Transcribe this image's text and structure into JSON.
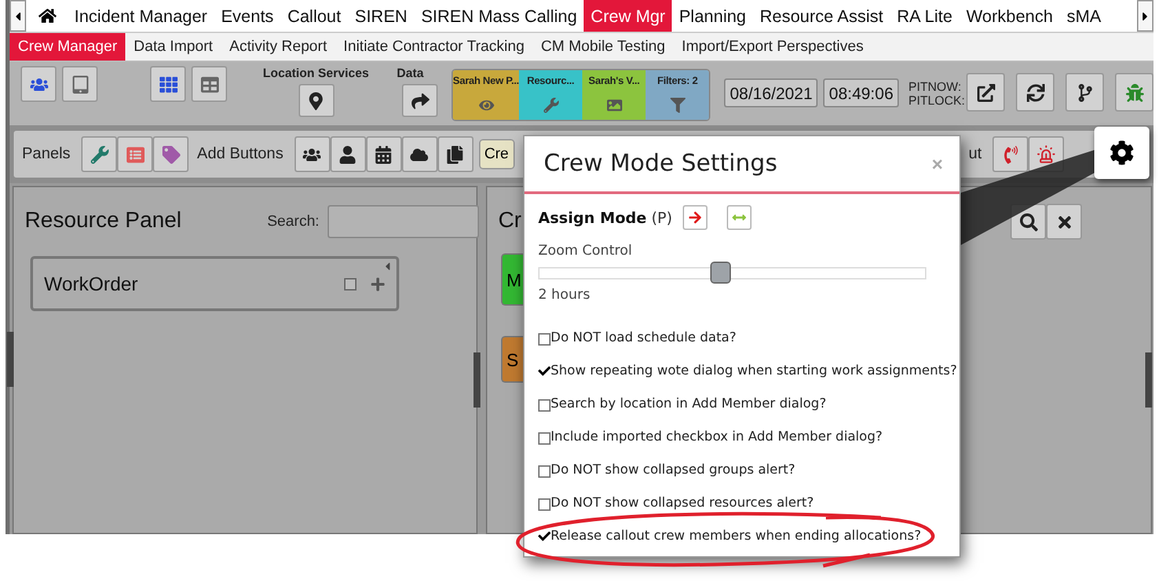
{
  "nav": {
    "tabs": [
      {
        "label": "Incident Manager",
        "selected": false
      },
      {
        "label": "Events",
        "selected": false
      },
      {
        "label": "Callout",
        "selected": false
      },
      {
        "label": "SIREN",
        "selected": false
      },
      {
        "label": "SIREN Mass Calling",
        "selected": false
      },
      {
        "label": "Crew Mgr",
        "selected": true
      },
      {
        "label": "Planning",
        "selected": false
      },
      {
        "label": "Resource Assist",
        "selected": false
      },
      {
        "label": "RA Lite",
        "selected": false
      },
      {
        "label": "Workbench",
        "selected": false
      },
      {
        "label": "sMA",
        "selected": false
      }
    ]
  },
  "subnav": {
    "tabs": [
      {
        "label": "Crew Manager",
        "selected": true
      },
      {
        "label": "Data Import",
        "selected": false
      },
      {
        "label": "Activity Report",
        "selected": false
      },
      {
        "label": "Initiate Contractor Tracking",
        "selected": false
      },
      {
        "label": "CM Mobile Testing",
        "selected": false
      },
      {
        "label": "Import/Export Perspectives",
        "selected": false
      }
    ]
  },
  "toolbar": {
    "location_label": "Location Services",
    "data_label": "Data",
    "perspectives": [
      {
        "label": "Sarah New P...",
        "color": "#c8a83c"
      },
      {
        "label": "Resourc...",
        "color": "#38c2c8"
      },
      {
        "label": "Sarah's V...",
        "color": "#8cc43e"
      },
      {
        "label": "Filters: 2",
        "color": "#80a8c4"
      }
    ],
    "date": "08/16/2021",
    "time": "08:49:06",
    "pit_labels": [
      "PITNOW:",
      "PITLOCK:"
    ]
  },
  "panels_bar": {
    "panels_label": "Panels",
    "add_buttons_label": "Add Buttons",
    "crew_chip": "Cre",
    "callout_fragment": "ut"
  },
  "resource_panel": {
    "title": "Resource Panel",
    "search_label": "Search:",
    "cards": [
      {
        "title": "WorkOrder",
        "checked": false
      }
    ]
  },
  "crew_panel": {
    "title": "Cr",
    "cards": [
      {
        "label": "M",
        "color": "#33b833"
      },
      {
        "label": "S",
        "color": "#c07a30"
      }
    ]
  },
  "dialog": {
    "title": "Crew Mode Settings",
    "close": "×",
    "assign_mode": "**Assign Mode** (P)",
    "zoom_label": "Zoom Control",
    "zoom": {
      "level": 0.47
    },
    "zoom_reading": "2 hours",
    "options": [
      {
        "label": "Do NOT load schedule data?",
        "checked": false
      },
      {
        "label": "Show repeating wote dialog when starting work assignments?",
        "checked": true
      },
      {
        "label": "Search by location in Add Member dialog?",
        "checked": false
      },
      {
        "label": "Include imported checkbox in Add Member dialog?",
        "checked": false
      },
      {
        "label": "Do NOT show collapsed groups alert?",
        "checked": false
      },
      {
        "label": "Do NOT show collapsed resources alert?",
        "checked": false
      },
      {
        "label": "Release callout crew members when ending allocations?",
        "checked": true
      }
    ]
  }
}
